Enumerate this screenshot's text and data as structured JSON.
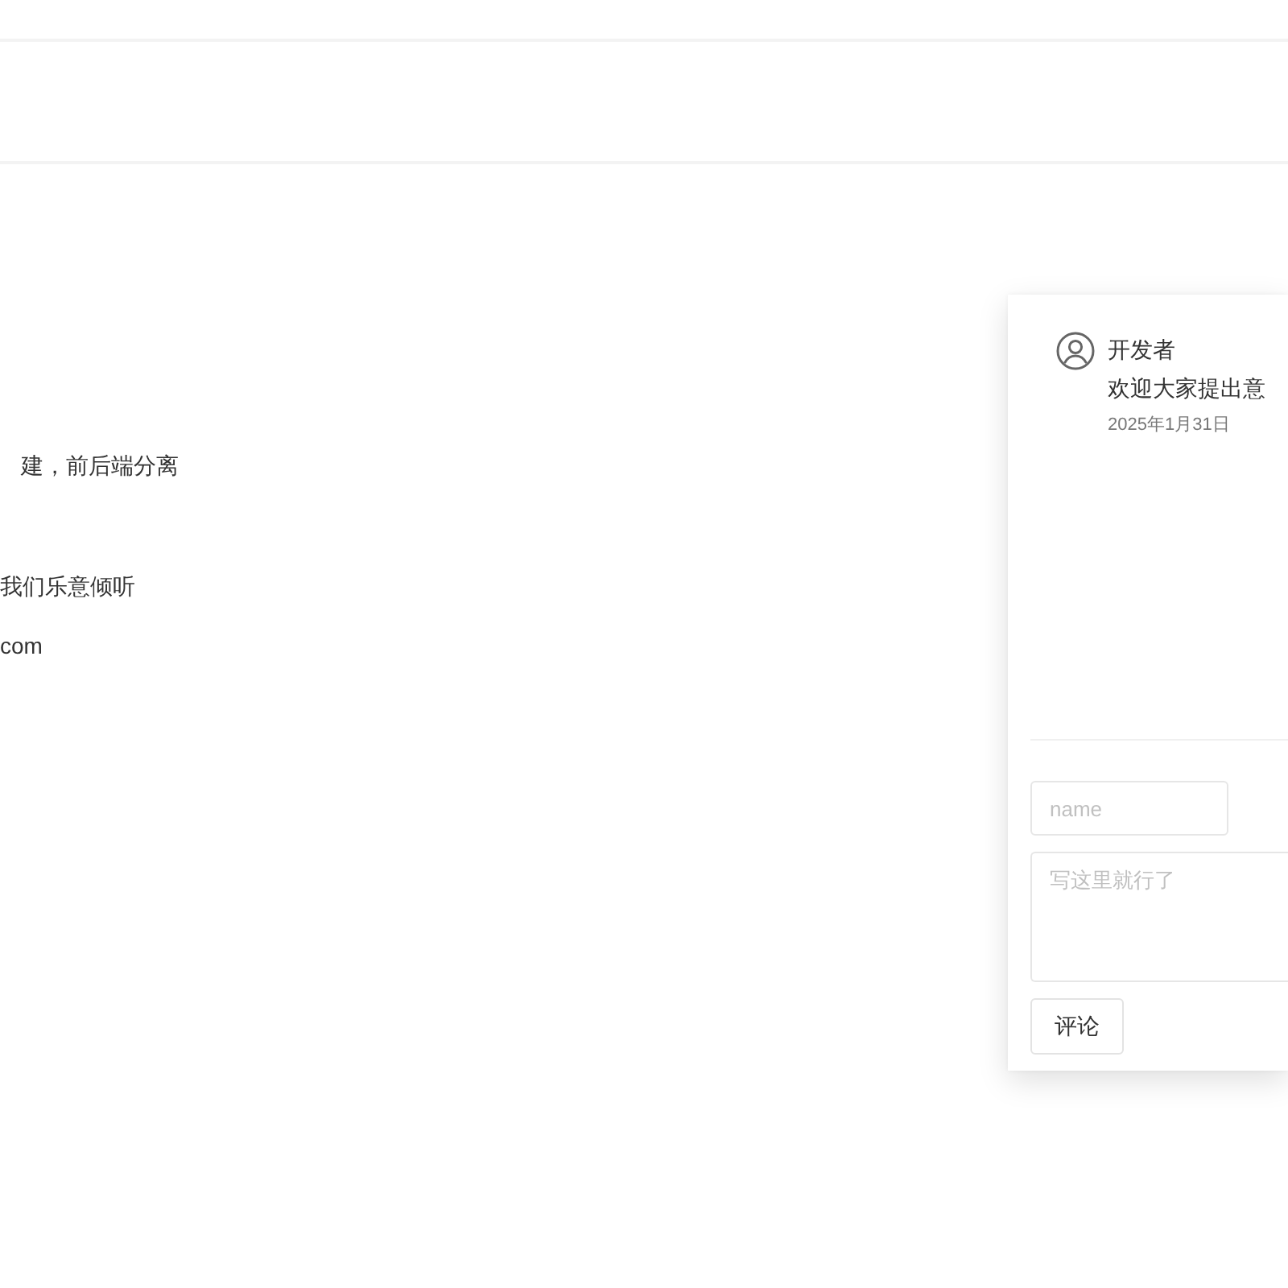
{
  "intro": {
    "lines": [
      "建，前后端分离",
      "我们乐意倾听",
      "com"
    ]
  },
  "comments": {
    "items": [
      {
        "author": "开发者",
        "text": "欢迎大家提出意",
        "date": "2025年1月31日"
      }
    ],
    "form": {
      "name_placeholder": "name",
      "content_placeholder": "写这里就行了",
      "submit": "评论"
    }
  }
}
